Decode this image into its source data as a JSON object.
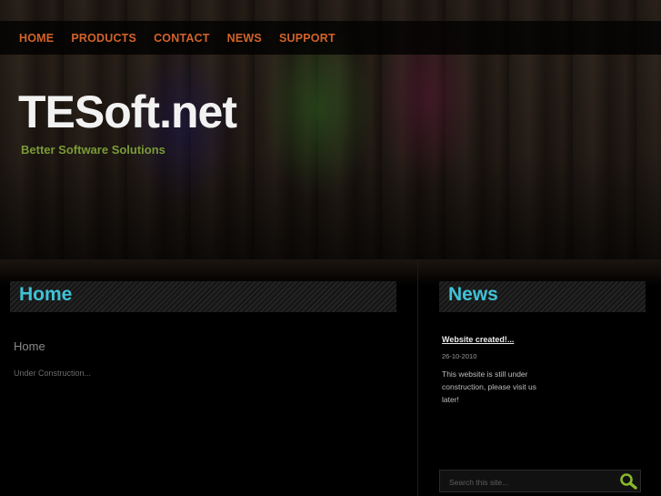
{
  "nav": {
    "items": [
      {
        "label": "HOME"
      },
      {
        "label": "PRODUCTS"
      },
      {
        "label": "CONTACT"
      },
      {
        "label": "NEWS"
      },
      {
        "label": "SUPPORT"
      }
    ]
  },
  "brand": {
    "title": "TESoft.net",
    "tagline": "Better Software Solutions"
  },
  "main": {
    "box_title": "Home",
    "heading": "Home",
    "body": "Under Construction..."
  },
  "sidebar": {
    "box_title": "News",
    "news": {
      "title": "Website created!...",
      "date": "26-10-2010",
      "text": "This website is still under construction, please visit us later!"
    },
    "search": {
      "placeholder": "Search this site...",
      "icon": "search-icon"
    }
  },
  "colors": {
    "nav_text": "#d2622a",
    "accent": "#3fc2d6",
    "tagline": "#7a9a36",
    "search_icon": "#8ab82a"
  }
}
